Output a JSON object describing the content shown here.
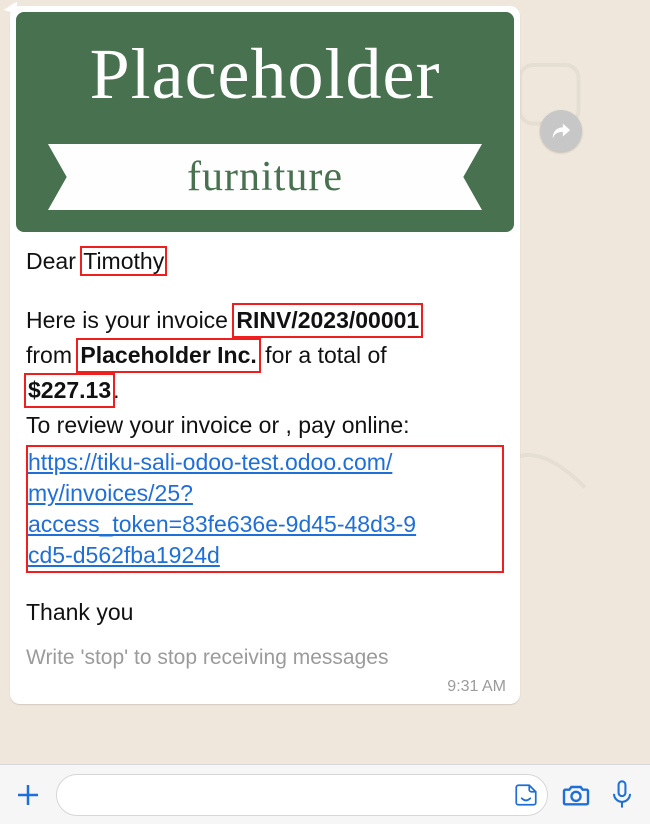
{
  "colors": {
    "brand": "#47714f",
    "accent_red": "#f01f1f",
    "link": "#1f6fd8"
  },
  "hero": {
    "brand_top": "Placeholder",
    "brand_bottom": "furniture"
  },
  "message": {
    "greeting_prefix": "Dear ",
    "greeting_name": "Timothy",
    "line1_a": "Here is your invoice ",
    "invoice_number": "RINV/2023/00001",
    "line2_a": "from ",
    "company": "Placeholder Inc.",
    "line2_b": " for a total of",
    "amount": "$227.13",
    "period": ".",
    "review_line": "To review your invoice or , pay online:",
    "link_lines": [
      "https://tiku-sali-odoo-test.odoo.com/",
      "my/invoices/25?",
      "access_token=83fe636e-9d45-48d3-9",
      "cd5-d562fba1924d"
    ],
    "thank_you": "Thank you",
    "footer_hint": "Write 'stop' to stop receiving messages",
    "timestamp": "9:31 AM"
  },
  "input": {
    "placeholder": ""
  }
}
